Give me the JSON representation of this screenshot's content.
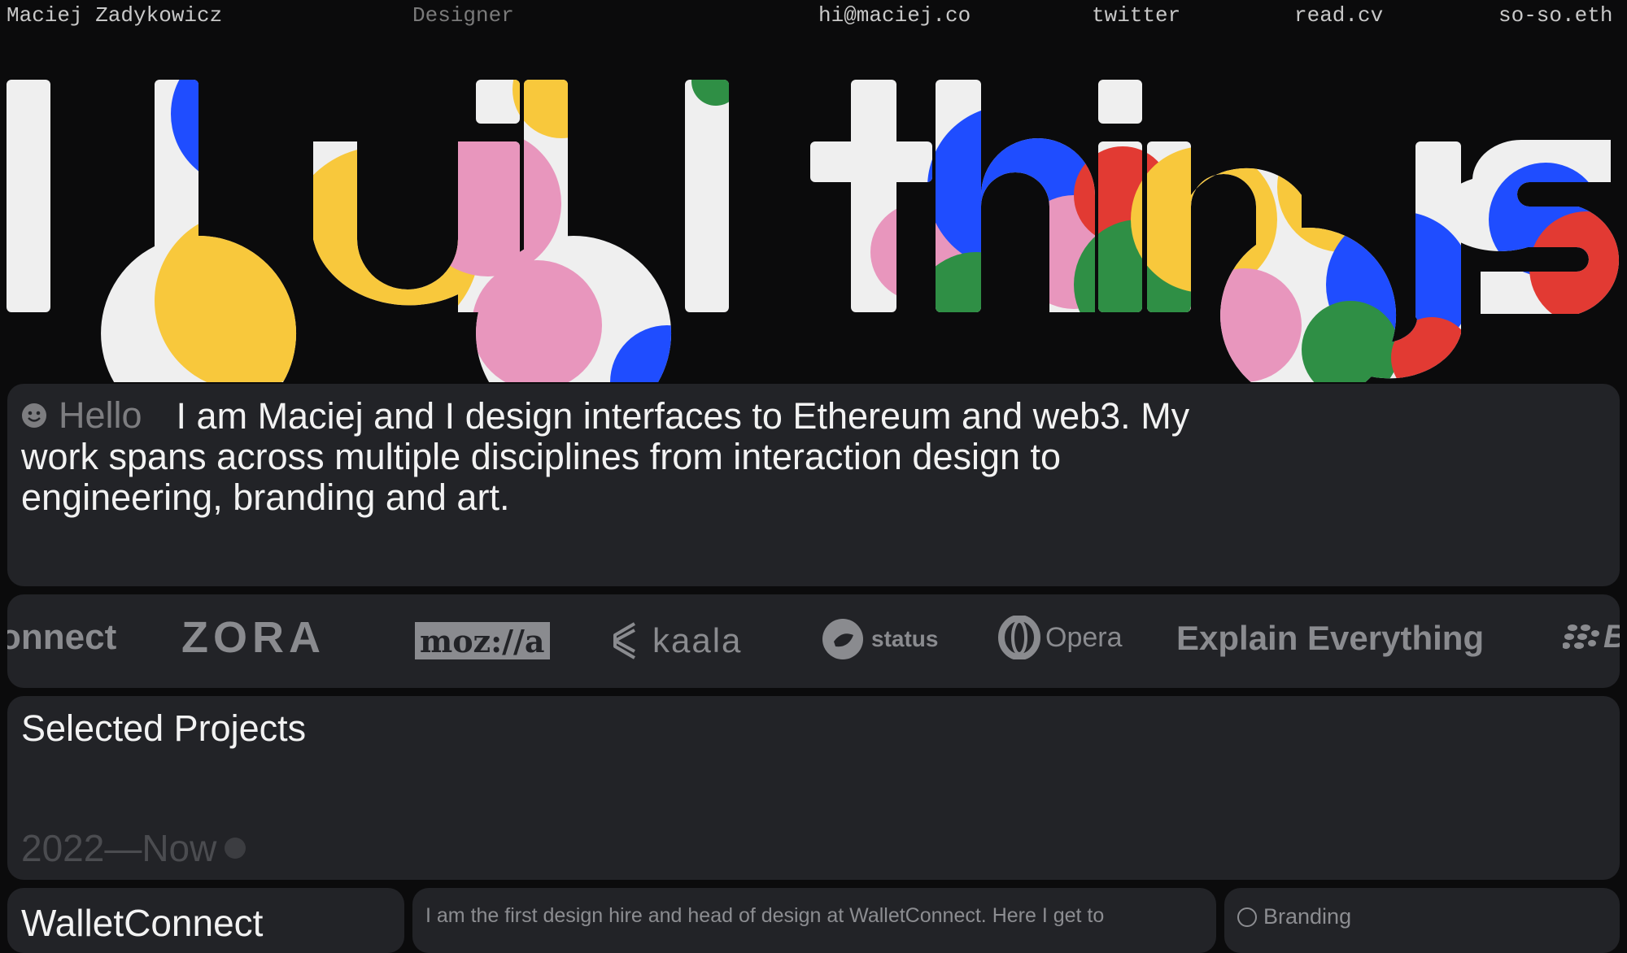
{
  "nav": {
    "name": "Maciej Zadykowicz",
    "role": "Designer",
    "email": "hi@maciej.co",
    "twitter": "twitter",
    "readcv": "read.cv",
    "ens": "so-so.eth"
  },
  "hero": {
    "headline": "I build things"
  },
  "intro": {
    "greeting": "Hello",
    "text": "I am Maciej and I design interfaces to Ethereum and web3. My work spans across multiple disciplines from interaction design to engineering, branding and art."
  },
  "clients": [
    {
      "name": "onnect",
      "icon": ""
    },
    {
      "name": "ZORA",
      "icon": ""
    },
    {
      "name": "moz://a",
      "icon": ""
    },
    {
      "name": "kaala",
      "icon": "kaala-icon"
    },
    {
      "name": "status",
      "icon": "status-icon"
    },
    {
      "name": "Opera",
      "icon": "opera-icon"
    },
    {
      "name": "Explain Everything",
      "icon": ""
    },
    {
      "name": "Bl",
      "icon": "blackberry-icon"
    }
  ],
  "projects": {
    "title": "Selected Projects",
    "period": "2022—Now",
    "first": {
      "name": "WalletConnect",
      "description": "I am the first design hire and head of design at WalletConnect. Here I get to",
      "tag": "Branding"
    }
  },
  "colors": {
    "background": "#0b0b0c",
    "card": "#222327",
    "white": "#efefef",
    "yellow": "#f8c83c",
    "blue": "#1f4dff",
    "pink": "#e896bd",
    "green": "#2f8f45",
    "red": "#e23a33"
  }
}
